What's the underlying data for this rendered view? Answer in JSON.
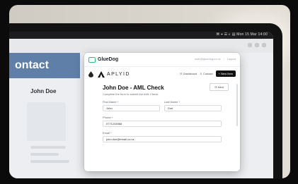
{
  "screen": {
    "menubar_status": "⌘  ⌖  ☰  ◐  ▤  Mon 15 Mar  14:00"
  },
  "background_page": {
    "header": "ontact",
    "contact_name": "John Doe"
  },
  "popup": {
    "brand": "GlueDog",
    "header_right": {
      "email": "user@gluedog.co.nz",
      "separator": "|",
      "logout": "Logout"
    },
    "nav": {
      "logo_text": "APLYID",
      "dashboard": "☷ Dashboard",
      "contact": "♙ Contact",
      "new_button": "+ New Item"
    },
    "form": {
      "title": "John Doe - AML Check",
      "subtitle": "Complete the form to submit the AML Check",
      "next_button": "⟳ Next",
      "first_name_label": "First Name *",
      "first_name_value": "John",
      "last_name_label": "Last Name *",
      "last_name_value": "Doe",
      "phone_label": "Phone *",
      "phone_value": "0771234568",
      "email_label": "Email *",
      "email_value": "john.doe@email.co.nz"
    }
  },
  "colors": {
    "background_header": "#5f7fa9",
    "gluedog_accent": "#2dbf7f",
    "new_button": "#111111"
  }
}
